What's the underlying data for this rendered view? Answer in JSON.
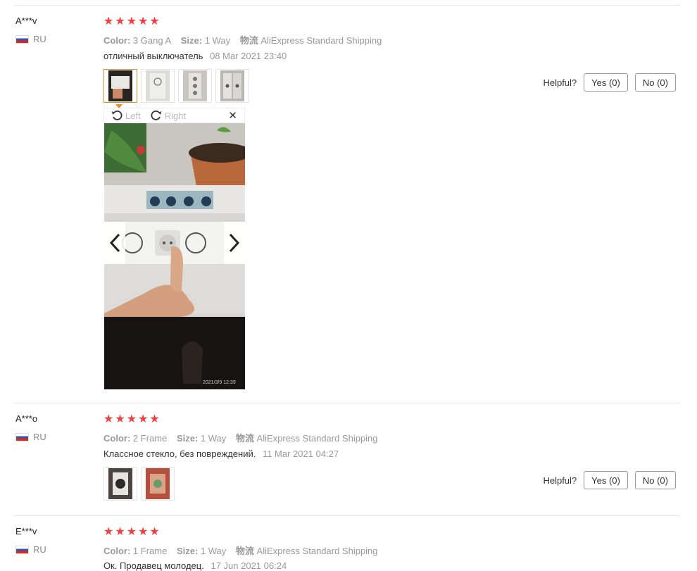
{
  "labels": {
    "color": "Color:",
    "size": "Size:",
    "shipping": "物流",
    "helpful": "Helpful?",
    "viewer_left": "Left",
    "viewer_right": "Right",
    "viewer_close": "✕"
  },
  "star_color": "#f0403f",
  "reviews": [
    {
      "user": "A***v",
      "country": "RU",
      "rating": 5,
      "color": "3 Gang A",
      "size": "1 Way",
      "shipping": "AliExpress Standard Shipping",
      "text": "отличный выключатель",
      "date": "08 Mar 2021 23:40",
      "yes": "Yes (0)",
      "no": "No (0)",
      "photo_count": 4
    },
    {
      "user": "A***o",
      "country": "RU",
      "rating": 5,
      "color": "2 Frame",
      "size": "1 Way",
      "shipping": "AliExpress Standard Shipping",
      "text": "Классное стекло, без повреждений.",
      "date": "11 Mar 2021 04:27",
      "yes": "Yes (0)",
      "no": "No (0)",
      "photo_count": 2
    },
    {
      "user": "E***v",
      "country": "RU",
      "rating": 5,
      "color": "1 Frame",
      "size": "1 Way",
      "shipping": "AliExpress Standard Shipping",
      "text": "Ок. Продавец молодец.",
      "date": "17 Jun 2021 06:24"
    }
  ],
  "photo_timestamp": "2021/3/9  12:39"
}
